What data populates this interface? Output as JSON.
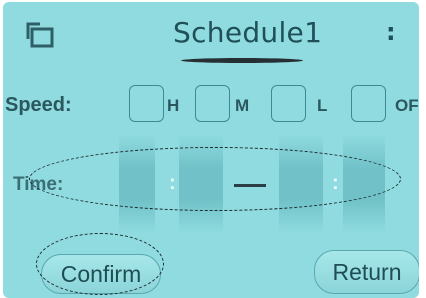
{
  "header": {
    "title": "Schedule1",
    "menu_symbol": ":",
    "back_icon": "window-back-icon"
  },
  "speed": {
    "label": "Speed:",
    "options": [
      "H",
      "M",
      "L",
      "OFF"
    ]
  },
  "time": {
    "label": "Time:",
    "separator": ":",
    "dash": "—"
  },
  "buttons": {
    "confirm": "Confirm",
    "return": "Return"
  },
  "colors": {
    "screen_bg": "#8fdbdf",
    "text": "#2a585e"
  }
}
